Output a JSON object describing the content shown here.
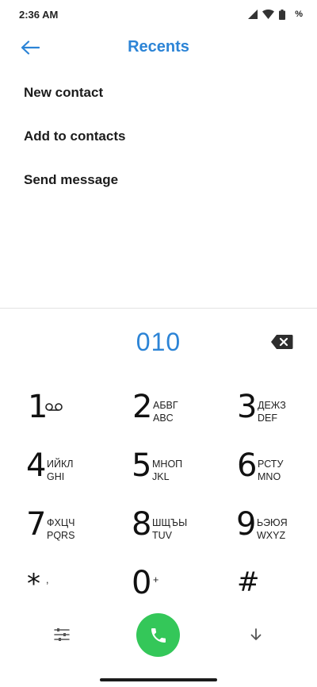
{
  "status": {
    "time": "2:36 AM",
    "battery_label": "%"
  },
  "header": {
    "title": "Recents",
    "back_icon": "arrow-left-icon"
  },
  "menu": {
    "items": [
      "New contact",
      "Add to contacts",
      "Send message"
    ]
  },
  "dialer": {
    "number": "010",
    "keys": [
      {
        "digit": "1",
        "ru": "",
        "en": ""
      },
      {
        "digit": "2",
        "ru": "АБВГ",
        "en": "ABC"
      },
      {
        "digit": "3",
        "ru": "ДЕЖЗ",
        "en": "DEF"
      },
      {
        "digit": "4",
        "ru": "ИЙКЛ",
        "en": "GHI"
      },
      {
        "digit": "5",
        "ru": "МНОП",
        "en": "JKL"
      },
      {
        "digit": "6",
        "ru": "РСТУ",
        "en": "MNO"
      },
      {
        "digit": "7",
        "ru": "ФХЦЧ",
        "en": "PQRS"
      },
      {
        "digit": "8",
        "ru": "ШЩЪЫ",
        "en": "TUV"
      },
      {
        "digit": "9",
        "ru": "ЬЭЮЯ",
        "en": "WXYZ"
      },
      {
        "digit": "*",
        "ru": ",",
        "en": ""
      },
      {
        "digit": "0",
        "ru": "+",
        "en": ""
      },
      {
        "digit": "#",
        "ru": "",
        "en": ""
      }
    ]
  },
  "colors": {
    "accent": "#2c84d6",
    "call_button": "#34c759"
  }
}
